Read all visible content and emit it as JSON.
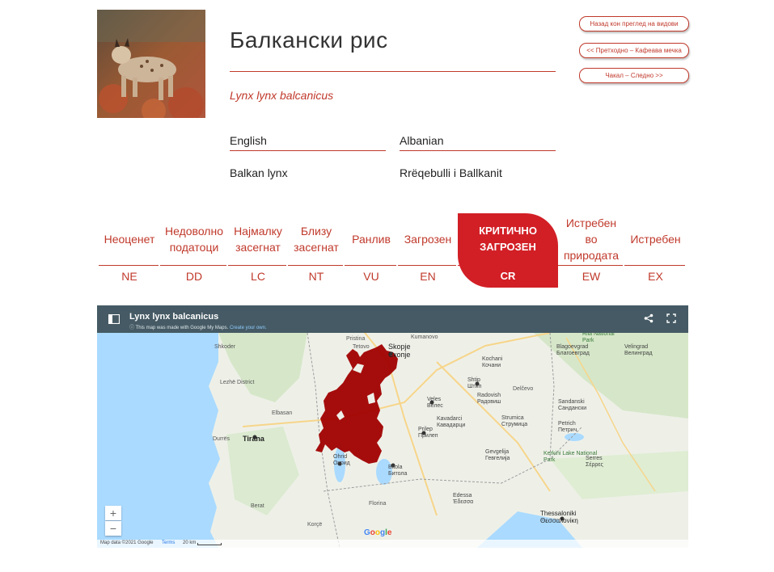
{
  "species": {
    "title": "Балкански рис",
    "scientific_name": "Lynx lynx balcanicus"
  },
  "nav": {
    "back": "Назад кон преглед на видови",
    "prev": "<< Претходно – Кафеава мечка",
    "next": "Чакал – Следно >>"
  },
  "languages": [
    {
      "language": "English",
      "name": "Balkan lynx"
    },
    {
      "language": "Albanian",
      "name": "Rrëqebulli i Ballkanit"
    }
  ],
  "statuses": [
    {
      "label": "Неоценет",
      "code": "NE",
      "active": false
    },
    {
      "label": "Недоволно податоци",
      "code": "DD",
      "active": false
    },
    {
      "label": "Најмалку засегнат",
      "code": "LC",
      "active": false
    },
    {
      "label": "Близу засегнат",
      "code": "NT",
      "active": false
    },
    {
      "label": "Ранлив",
      "code": "VU",
      "active": false
    },
    {
      "label": "Загрозен",
      "code": "EN",
      "active": false
    },
    {
      "label": "КРИТИЧНО ЗАГРОЗЕН",
      "code": "CR",
      "active": true
    },
    {
      "label": "Истребен во природата",
      "code": "EW",
      "active": false
    },
    {
      "label": "Истребен",
      "code": "EX",
      "active": false
    }
  ],
  "map": {
    "title": "Lynx lynx balcanicus",
    "subtitle": "This map was made with Google My Maps.",
    "create_link": "Create your own.",
    "zoom_in": "+",
    "zoom_out": "−",
    "footer_data": "Map data ©2021 Google",
    "footer_terms": "Terms",
    "footer_scale": "20 km",
    "labels": [
      "Shkoder",
      "Lezhë District",
      "Tirana",
      "Durrës",
      "Berat",
      "Ohrid Охрид",
      "Bitola Битола",
      "Prilep Прилеп",
      "Veles Велес",
      "Skopje Скопје",
      "Kochani Кочани",
      "Shtip Штип",
      "Strumica Струмица",
      "Gevgelija Гевгелија",
      "Edessa Έδεσσα",
      "Thessaloniki Θεσσαλονίκη",
      "Kerkini Lake National Park",
      "Serres Σέρρες",
      "Sandanski Сандански",
      "Petrich Петрич",
      "Blagoevgrad Благоевград",
      "Rila National Park",
      "Velingrad Велинград",
      "Kavadarci Кавадарци",
      "Radovish Радовиш",
      "Florina",
      "Korçë",
      "Tetovo",
      "Kumanovo",
      "Pristina",
      "Elbasan",
      "Delčevo"
    ]
  },
  "colors": {
    "accent": "#c0392b",
    "active_status": "#d21f26",
    "map_header": "#455a64",
    "range": "#a00000",
    "water": "#aadaff",
    "land": "#eef0e8"
  },
  "icons": {
    "sidebar": "sidebar-toggle-icon",
    "share": "share-icon",
    "fullscreen": "fullscreen-icon"
  }
}
